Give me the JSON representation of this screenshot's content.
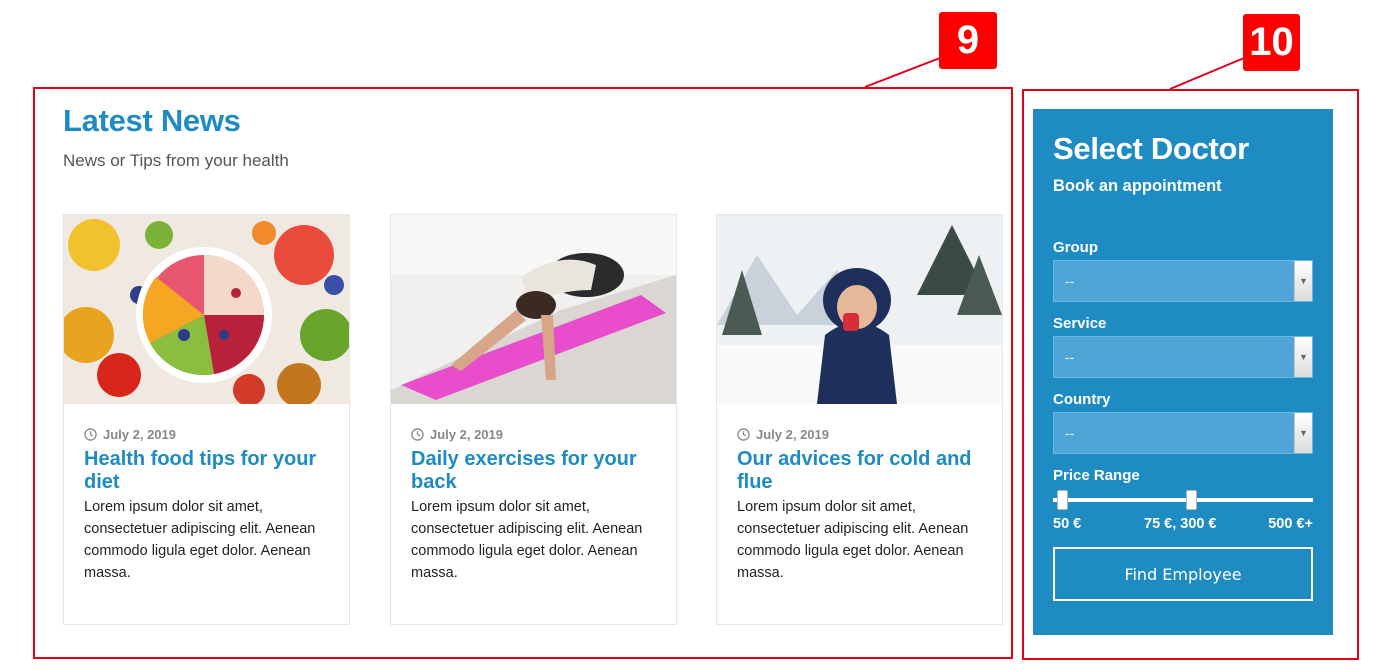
{
  "annotations": {
    "news_badge": "9",
    "doctor_badge": "10"
  },
  "news": {
    "title": "Latest News",
    "subtitle": "News or Tips from your health",
    "articles": [
      {
        "date": "July 2, 2019",
        "title": "Health food tips for your diet",
        "excerpt": "Lorem ipsum dolor sit amet, consectetuer adipiscing elit. Aenean commodo ligula eget dolor. Aenean massa.",
        "image": "fruit-bowl-photo"
      },
      {
        "date": "July 2, 2019",
        "title": "Daily exercises for your back",
        "excerpt": "Lorem ipsum dolor sit amet, consectetuer adipiscing elit. Aenean commodo ligula eget dolor. Aenean massa.",
        "image": "yoga-mat-photo"
      },
      {
        "date": "July 2, 2019",
        "title": "Our advices for cold and flue",
        "excerpt": "Lorem ipsum dolor sit amet, consectetuer adipiscing elit. Aenean commodo ligula eget dolor. Aenean massa.",
        "image": "winter-snow-photo"
      }
    ]
  },
  "doctor_form": {
    "title": "Select Doctor",
    "subtitle": "Book an appointment",
    "fields": [
      {
        "label": "Group",
        "value": "--"
      },
      {
        "label": "Service",
        "value": "--"
      },
      {
        "label": "Country",
        "value": "--"
      }
    ],
    "price_range": {
      "label": "Price Range",
      "min_label": "50 €",
      "selected_label": "75 €, 300 €",
      "max_label": "500 €+"
    },
    "button_label": "Find Employee"
  },
  "colors": {
    "brand_blue": "#1e8bc3",
    "annotation_red": "#e3001b"
  }
}
